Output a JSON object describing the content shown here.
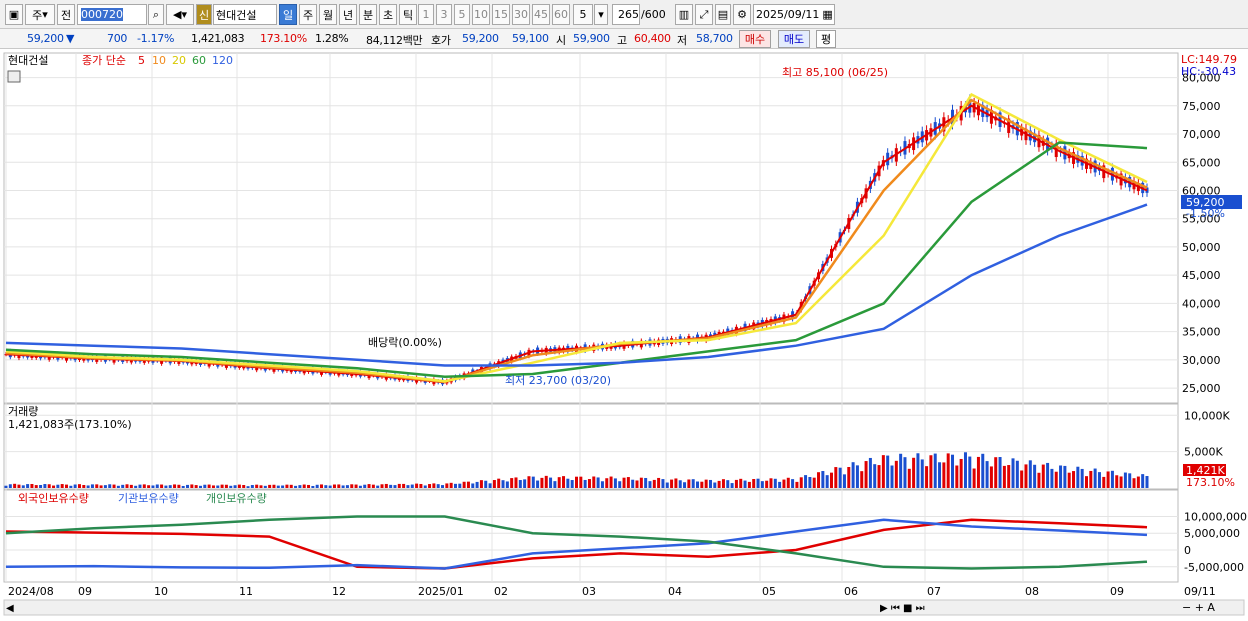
{
  "toolbar": {
    "mode": "주",
    "prev": "전",
    "code": "000720",
    "new_badge": "신",
    "stock_name": "현대건설",
    "periods": [
      "일",
      "주",
      "월",
      "년",
      "분",
      "초",
      "틱"
    ],
    "nums": [
      "1",
      "3",
      "5",
      "10",
      "15",
      "30",
      "45",
      "60"
    ],
    "count_sel": "5",
    "view": "265",
    "total": "/600",
    "date": "2025/09/11",
    "icons": [
      "calendar-icon",
      "search-icon",
      "speaker-icon",
      "candle-icon",
      "draw-icon",
      "save-icon",
      "gear-icon"
    ]
  },
  "quote": {
    "price": "59,200",
    "arrow": "▼",
    "change": "700",
    "change_pct": "-1.17%",
    "volume": "1,421,083",
    "vol_ratio": "173.10%",
    "turnover": "1.28%",
    "amount": "84,112백만",
    "bid_label": "호가",
    "ask": "59,200",
    "bid": "59,100",
    "open_label": "시",
    "open": "59,900",
    "high_label": "고",
    "high": "60,400",
    "low_label": "저",
    "low": "58,700",
    "buy": "매수",
    "sell": "매도",
    "eval": "평"
  },
  "legend": {
    "name": "현대건설",
    "ma_label": "종가 단순",
    "ma5": "5",
    "ma10": "10",
    "ma20": "20",
    "ma60": "60",
    "ma120": "120",
    "lc": "LC:149.79",
    "hc": "HC:-30.43",
    "cur_price": "59,200",
    "cur_pct": "-1.50%",
    "hi_note": "최고 85,100 (06/25)",
    "lo_note": "최저 23,700 (03/20)",
    "div_note": "배당락(0.00%)",
    "vol_title": "거래량",
    "vol_value": "1,421,083주(173.10%)",
    "vol_tag": "1,421K",
    "vol_tag_pct": "173.10%",
    "flow_f": "외국인보유수량",
    "flow_i": "기관보유수량",
    "flow_p": "개인보유수량"
  },
  "axes": {
    "price_ticks": [
      "80,000",
      "75,000",
      "70,000",
      "65,000",
      "60,000",
      "55,000",
      "50,000",
      "45,000",
      "40,000",
      "35,000",
      "30,000",
      "25,000"
    ],
    "vol_ticks": [
      "10,000K",
      "5,000K"
    ],
    "flow_ticks": [
      "10,000,000",
      "5,000,000",
      "0",
      "-5,000,000"
    ],
    "months": [
      "2024/08",
      "09",
      "10",
      "11",
      "12",
      "2025/01",
      "02",
      "03",
      "04",
      "05",
      "06",
      "07",
      "08",
      "09"
    ],
    "right_date": "09/11"
  },
  "colors": {
    "up": "#e00000",
    "down": "#1a4fd0",
    "ma5": "#e00000",
    "ma10": "#f08a1c",
    "ma20": "#f5e83a",
    "ma60": "#2a9a3a",
    "ma120": "#3060e0",
    "foreign": "#e00000",
    "inst": "#3060e0",
    "indiv": "#2a8a50"
  },
  "chart_data": {
    "type": "line",
    "x": [
      "2024-08",
      "2024-09",
      "2024-10",
      "2024-11",
      "2024-12",
      "2025-01",
      "2025-02",
      "2025-03",
      "2025-04",
      "2025-05",
      "2025-06",
      "2025-07",
      "2025-08",
      "2025-09"
    ],
    "series": [
      {
        "name": "5",
        "values": [
          31000,
          30200,
          29800,
          28500,
          27500,
          26000,
          31500,
          32500,
          34000,
          38000,
          65000,
          75000,
          67000,
          60000
        ]
      },
      {
        "name": "10",
        "values": [
          31200,
          30300,
          29900,
          28700,
          27700,
          26100,
          30800,
          32800,
          33800,
          37500,
          60000,
          76000,
          67500,
          60500
        ]
      },
      {
        "name": "20",
        "values": [
          31500,
          30500,
          30000,
          29000,
          28000,
          26200,
          29500,
          33000,
          33500,
          36500,
          52000,
          77000,
          69000,
          61500
        ]
      },
      {
        "name": "60",
        "values": [
          31800,
          31000,
          30500,
          29500,
          28500,
          27000,
          27500,
          29500,
          31500,
          33500,
          40000,
          58000,
          68500,
          67500
        ]
      },
      {
        "name": "120",
        "values": [
          33000,
          32500,
          32000,
          31000,
          30000,
          29000,
          29000,
          29500,
          30500,
          32500,
          35500,
          45000,
          52000,
          57500
        ]
      }
    ],
    "ylim": [
      22000,
      84000
    ],
    "volume_k": [
      450,
      400,
      380,
      350,
      400,
      500,
      1300,
      1200,
      900,
      1100,
      3600,
      3800,
      2500,
      1421
    ],
    "flows": {
      "foreign": [
        5500000,
        5200000,
        4800000,
        4000000,
        -5000000,
        -5500000,
        -2500000,
        -1000000,
        -2000000,
        0,
        6000000,
        9000000,
        8000000,
        6800000
      ],
      "inst": [
        -5000000,
        -4800000,
        -5200000,
        -5300000,
        -4500000,
        -5500000,
        -1000000,
        500000,
        2000000,
        5500000,
        9000000,
        7000000,
        5800000,
        4500000
      ],
      "indiv": [
        5000000,
        6500000,
        7500000,
        9000000,
        10000000,
        10000000,
        5000000,
        4000000,
        2500000,
        -1000000,
        -5000000,
        -5500000,
        -5000000,
        -3500000
      ]
    }
  }
}
